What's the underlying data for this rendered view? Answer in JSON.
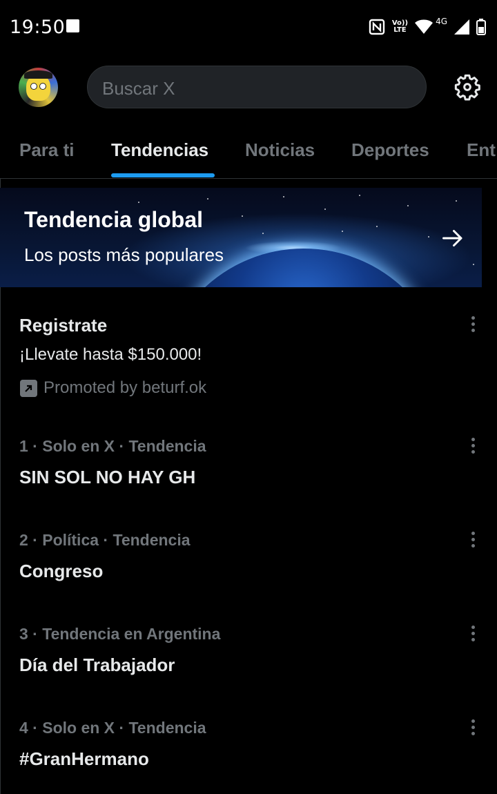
{
  "status_bar": {
    "time": "19:50",
    "network_label": "4G",
    "volte_label": "Vo))\nLTE",
    "icons": [
      "notification-square-icon",
      "nfc-icon",
      "volte-icon",
      "wifi-icon",
      "signal-icon",
      "battery-icon"
    ]
  },
  "header": {
    "search_placeholder": "Buscar X",
    "icons": [
      "avatar",
      "settings-gear-icon"
    ]
  },
  "tabs": [
    {
      "label": "Para ti",
      "active": false
    },
    {
      "label": "Tendencias",
      "active": true
    },
    {
      "label": "Noticias",
      "active": false
    },
    {
      "label": "Deportes",
      "active": false
    },
    {
      "label": "Ent",
      "active": false
    }
  ],
  "banner": {
    "title": "Tendencia global",
    "subtitle": "Los posts más populares",
    "icon": "arrow-right-icon"
  },
  "promoted": {
    "title": "Registrate",
    "description": "¡Llevate hasta $150.000!",
    "promoted_by": "Promoted by beturf.ok"
  },
  "trends": [
    {
      "meta": "1 · Solo en X · Tendencia",
      "title": "SIN SOL NO HAY GH"
    },
    {
      "meta": "2 · Política · Tendencia",
      "title": "Congreso"
    },
    {
      "meta": "3 · Tendencia en Argentina",
      "title": "Día del Trabajador"
    },
    {
      "meta": "4 · Solo en X · Tendencia",
      "title": "#GranHermano"
    }
  ],
  "colors": {
    "background": "#000000",
    "accent": "#1d9bf0",
    "secondary_text": "#71767b",
    "primary_text": "#e7e9ea"
  }
}
